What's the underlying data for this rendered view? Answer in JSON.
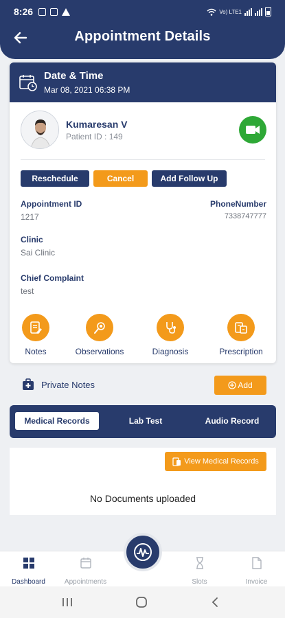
{
  "status_bar": {
    "time": "8:26",
    "network": "Vo) LTE1"
  },
  "header": {
    "title": "Appointment Details"
  },
  "appointment": {
    "date_time_label": "Date & Time",
    "date_time": "Mar 08, 2021 06:38 PM",
    "patient_name": "Kumaresan V",
    "patient_id": "Patient ID : 149",
    "actions": {
      "reschedule": "Reschedule",
      "cancel": "Cancel",
      "follow_up": "Add Follow Up"
    },
    "appointment_id_label": "Appointment ID",
    "appointment_id": "1217",
    "phone_label": "PhoneNumber",
    "phone": "7338747777",
    "clinic_label": "Clinic",
    "clinic": "Sai Clinic",
    "complaint_label": "Chief Complaint",
    "complaint": "test"
  },
  "quick_actions": [
    {
      "label": "Notes",
      "icon": "notes-icon"
    },
    {
      "label": "Observations",
      "icon": "stethoscope-icon"
    },
    {
      "label": "Diagnosis",
      "icon": "diagnosis-icon"
    },
    {
      "label": "Prescription",
      "icon": "prescription-icon"
    }
  ],
  "private_notes": {
    "label": "Private Notes",
    "add_label": "Add"
  },
  "tabs": [
    {
      "label": "Medical Records",
      "active": true
    },
    {
      "label": "Lab Test",
      "active": false
    },
    {
      "label": "Audio Record",
      "active": false
    }
  ],
  "documents": {
    "view_label": "View Medical Records",
    "empty_text": "No Documents uploaded"
  },
  "bottom_nav": [
    {
      "label": "Dashboard",
      "icon": "dashboard-icon",
      "active": true
    },
    {
      "label": "Appointments",
      "icon": "calendar-icon",
      "active": false
    },
    {
      "label": "Slots",
      "icon": "hourglass-icon",
      "active": false
    },
    {
      "label": "Invoice",
      "icon": "document-icon",
      "active": false
    }
  ],
  "colors": {
    "primary": "#283b6c",
    "accent": "#f39a1b",
    "success": "#2ea836"
  }
}
